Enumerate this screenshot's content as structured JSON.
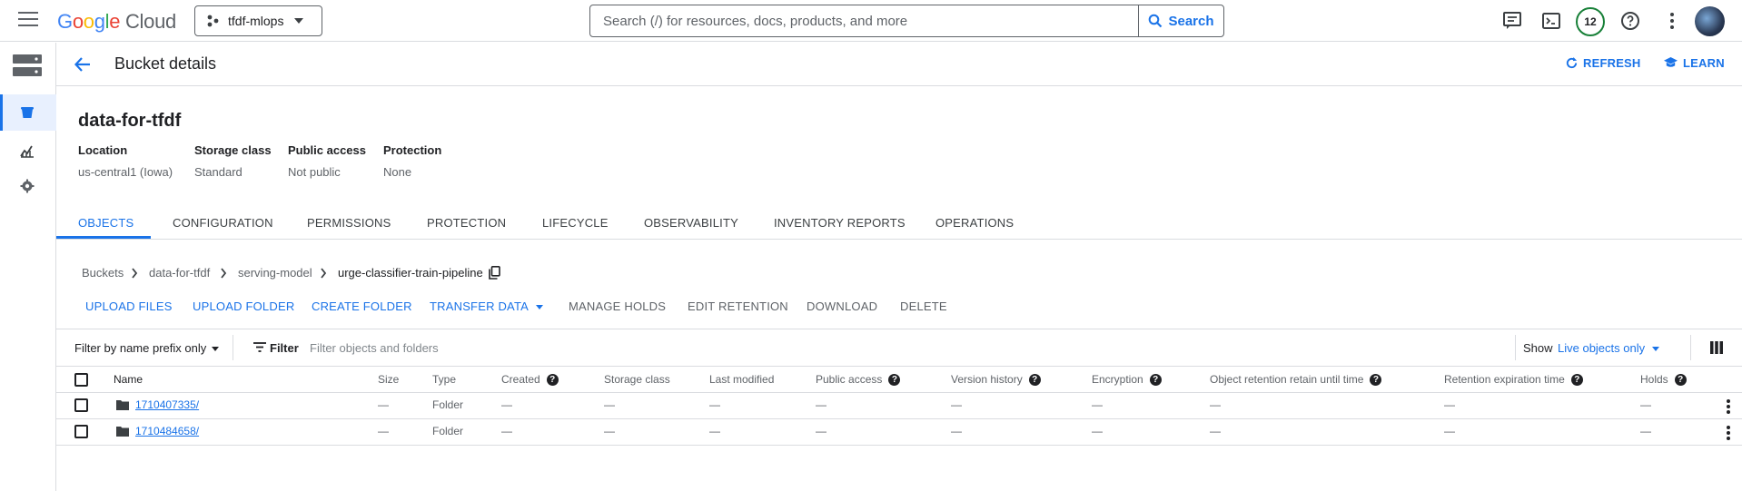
{
  "topbar": {
    "logo": {
      "g": "G",
      "o1": "o",
      "o2": "o",
      "g2": "g",
      "l": "l",
      "e": "e",
      "cloud": "Cloud"
    },
    "project": "tfdf-mlops",
    "search_placeholder": "Search (/) for resources, docs, products, and more",
    "search_button": "Search",
    "notification_count": "12"
  },
  "header": {
    "title": "Bucket details",
    "refresh": "REFRESH",
    "learn": "LEARN"
  },
  "bucket": {
    "name": "data-for-tfdf",
    "meta": [
      {
        "label": "Location",
        "value": "us-central1 (Iowa)"
      },
      {
        "label": "Storage class",
        "value": "Standard"
      },
      {
        "label": "Public access",
        "value": "Not public"
      },
      {
        "label": "Protection",
        "value": "None"
      }
    ]
  },
  "tabs": [
    "OBJECTS",
    "CONFIGURATION",
    "PERMISSIONS",
    "PROTECTION",
    "LIFECYCLE",
    "OBSERVABILITY",
    "INVENTORY REPORTS",
    "OPERATIONS"
  ],
  "breadcrumb": [
    "Buckets",
    "data-for-tfdf",
    "serving-model",
    "urge-classifier-train-pipeline"
  ],
  "actions": {
    "upload_files": "UPLOAD FILES",
    "upload_folder": "UPLOAD FOLDER",
    "create_folder": "CREATE FOLDER",
    "transfer_data": "TRANSFER DATA",
    "manage_holds": "MANAGE HOLDS",
    "edit_retention": "EDIT RETENTION",
    "download": "DOWNLOAD",
    "delete": "DELETE"
  },
  "filter": {
    "mode": "Filter by name prefix only",
    "filter_label": "Filter",
    "placeholder": "Filter objects and folders",
    "show_label": "Show",
    "show_value": "Live objects only"
  },
  "table": {
    "columns": [
      "Name",
      "Size",
      "Type",
      "Created",
      "Storage class",
      "Last modified",
      "Public access",
      "Version history",
      "Encryption",
      "Object retention retain until time",
      "Retention expiration time",
      "Holds"
    ],
    "rows": [
      {
        "name": "1710407335/",
        "size": "—",
        "type": "Folder",
        "created": "—",
        "storage_class": "—",
        "last_modified": "—",
        "public_access": "—",
        "version_history": "—",
        "encryption": "—",
        "retain_until": "—",
        "retention_expiration": "—",
        "holds": "—"
      },
      {
        "name": "1710484658/",
        "size": "—",
        "type": "Folder",
        "created": "—",
        "storage_class": "—",
        "last_modified": "—",
        "public_access": "—",
        "version_history": "—",
        "encryption": "—",
        "retain_until": "—",
        "retention_expiration": "—",
        "holds": "—"
      }
    ]
  },
  "colors": {
    "accent": "#1a73e8",
    "border": "#dadce0",
    "muted": "#5f6368",
    "active_nav_bg": "#e8f0fe"
  }
}
